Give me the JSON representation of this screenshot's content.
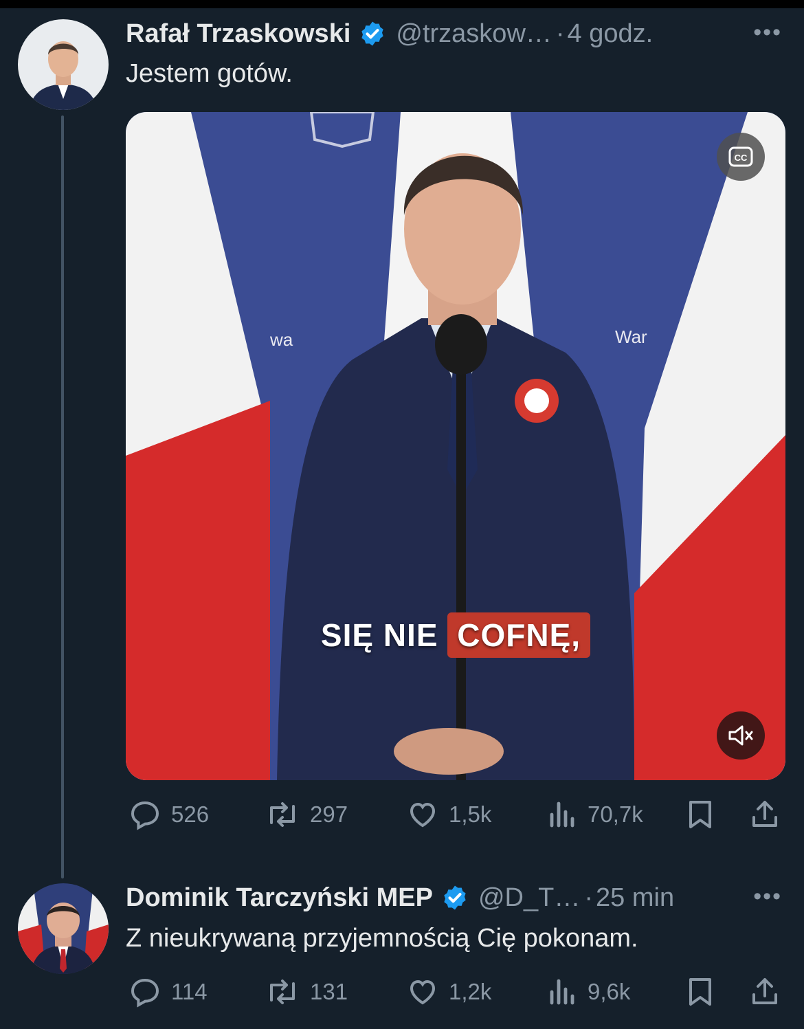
{
  "tweets": [
    {
      "name": "Rafał Trzaskowski",
      "handle": "@trzaskow…",
      "time": "4 godz.",
      "text": "Jestem gotów.",
      "video": {
        "caption_part1": "SIĘ NIE",
        "caption_highlight": "COFNĘ,",
        "cc_label": "CC",
        "backdrop_text_left": "wa",
        "backdrop_text_right": "War"
      },
      "stats": {
        "replies": "526",
        "reposts": "297",
        "likes": "1,5k",
        "views": "70,7k"
      }
    },
    {
      "name": "Dominik Tarczyński MEP",
      "handle": "@D_T…",
      "time": "25 min",
      "text": "Z nieukrywaną przyjemnością Cię pokonam.",
      "stats": {
        "replies": "114",
        "reposts": "131",
        "likes": "1,2k",
        "views": "9,6k"
      }
    }
  ],
  "colors": {
    "background": "#15202b",
    "verified": "#1d9bf0",
    "muted_text": "#8b98a5",
    "thread_line": "#425364",
    "caption_highlight": "#c0392b"
  },
  "icons": [
    "verified-badge-icon",
    "more-icon",
    "reply-icon",
    "repost-icon",
    "like-icon",
    "views-icon",
    "bookmark-icon",
    "share-icon",
    "cc-icon",
    "mute-icon"
  ]
}
